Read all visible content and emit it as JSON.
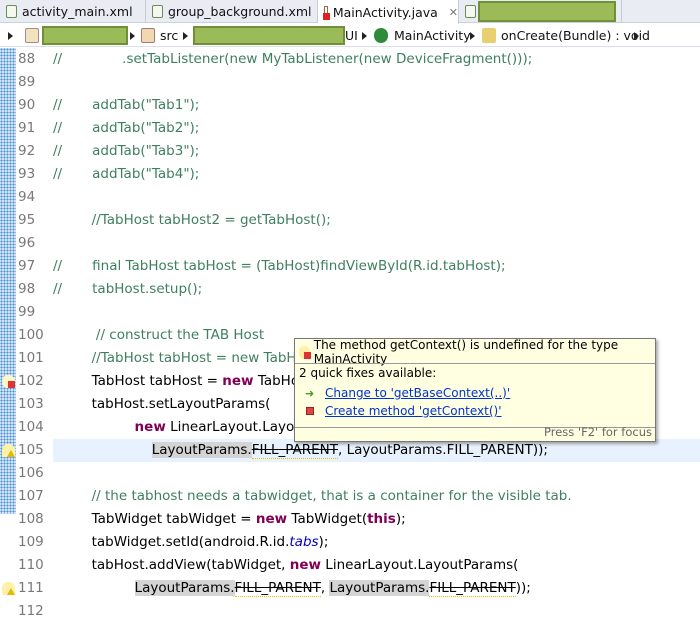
{
  "tabs": [
    {
      "label": "activity_main.xml",
      "icon": "xml-file-icon"
    },
    {
      "label": "group_background.xml",
      "icon": "xml-file-icon"
    },
    {
      "label": "MainActivity.java",
      "icon": "java-file-error-icon",
      "active": true,
      "close": "✕"
    },
    {
      "label": "",
      "icon": "xml-file-icon",
      "redacted": true
    }
  ],
  "breadcrumb": {
    "project": "",
    "src": "src",
    "package_suffix": "UI",
    "class": "MainActivity",
    "method": "onCreate(Bundle) : void"
  },
  "editor": {
    "current_line": 105,
    "lines": [
      {
        "n": 88,
        "seg": [
          [
            "//              .setTabListener(new MyTabListener(new DeviceFragment()));",
            "comment"
          ]
        ]
      },
      {
        "n": 89,
        "seg": []
      },
      {
        "n": 90,
        "seg": [
          [
            "//       addTab(\"Tab1\");",
            "comment"
          ]
        ]
      },
      {
        "n": 91,
        "seg": [
          [
            "//       addTab(\"Tab2\");",
            "comment"
          ]
        ]
      },
      {
        "n": 92,
        "seg": [
          [
            "//       addTab(\"Tab3\");",
            "comment"
          ]
        ]
      },
      {
        "n": 93,
        "seg": [
          [
            "//       addTab(\"Tab4\");",
            "comment"
          ]
        ]
      },
      {
        "n": 94,
        "seg": []
      },
      {
        "n": 95,
        "seg": [
          [
            "         //TabHost tabHost2 = getTabHost();",
            "comment"
          ]
        ]
      },
      {
        "n": 96,
        "seg": []
      },
      {
        "n": 97,
        "seg": [
          [
            "//       final TabHost tabHost = (TabHost)findViewById(R.id.tabHost);",
            "comment"
          ]
        ]
      },
      {
        "n": 98,
        "seg": [
          [
            "//       tabHost.setup();",
            "comment"
          ]
        ]
      },
      {
        "n": 99,
        "seg": []
      },
      {
        "n": 100,
        "seg": [
          [
            "          // construct the TAB Host",
            "comment"
          ]
        ]
      },
      {
        "n": 101,
        "seg": [
          [
            "         //TabHost tabHost = new TabHost(this);",
            "comment"
          ]
        ]
      },
      {
        "n": 102,
        "marker": "error",
        "seg": [
          [
            "         TabHost tabHost = ",
            ""
          ],
          [
            "new",
            "kw"
          ],
          [
            " TabHost(",
            ""
          ],
          [
            "getContext",
            "spell"
          ],
          [
            "(), ",
            ""
          ],
          [
            "null",
            "kw"
          ],
          [
            ");",
            ""
          ]
        ]
      },
      {
        "n": 103,
        "seg": [
          [
            "         tabHost.setLayoutParams(",
            ""
          ]
        ]
      },
      {
        "n": 104,
        "seg": [
          [
            "                   ",
            ""
          ],
          [
            "new",
            "kw"
          ],
          [
            " LinearLayout.LayoutParams(",
            ""
          ]
        ]
      },
      {
        "n": 105,
        "marker": "warning",
        "seg": [
          [
            "                       ",
            ""
          ],
          [
            "LayoutParams.",
            "hl"
          ],
          [
            "FILL_PARENT",
            "dep"
          ],
          [
            ", LayoutParams.FILL_PARENT));",
            ""
          ]
        ]
      },
      {
        "n": 106,
        "seg": []
      },
      {
        "n": 107,
        "seg": [
          [
            "         // the tabhost needs a tabwidget, that is a container for the visible tab.",
            "comment"
          ]
        ]
      },
      {
        "n": 108,
        "seg": [
          [
            "         TabWidget tabWidget = ",
            ""
          ],
          [
            "new",
            "kw"
          ],
          [
            " TabWidget(",
            ""
          ],
          [
            "this",
            "kw"
          ],
          [
            ");",
            ""
          ]
        ]
      },
      {
        "n": 109,
        "seg": [
          [
            "         tabWidget.setId(android.R.id.",
            ""
          ],
          [
            "tabs",
            "field"
          ],
          [
            ");",
            ""
          ]
        ]
      },
      {
        "n": 110,
        "seg": [
          [
            "         tabHost.addView(tabWidget, ",
            ""
          ],
          [
            "new",
            "kw"
          ],
          [
            " LinearLayout.LayoutParams(",
            ""
          ]
        ]
      },
      {
        "n": 111,
        "marker": "warning",
        "seg": [
          [
            "                   ",
            ""
          ],
          [
            "LayoutParams.",
            "hl"
          ],
          [
            "FILL_PARENT",
            "dep"
          ],
          [
            ", ",
            ""
          ],
          [
            "LayoutParams.",
            "hl"
          ],
          [
            "FILL_PARENT",
            "dep"
          ],
          [
            "));",
            ""
          ]
        ]
      },
      {
        "n": 112,
        "seg": []
      }
    ]
  },
  "hover": {
    "message": "The method getContext() is undefined for the type MainActivity",
    "count_text": "2 quick fixes available:",
    "fixes": [
      {
        "label": "Change to 'getBaseContext(..)'",
        "icon": "rename-arrow-icon"
      },
      {
        "label": "Create method 'getContext()'",
        "icon": "method-icon"
      }
    ],
    "footer": "Press 'F2' for focus"
  },
  "colors": {
    "keyword": "#7f0055",
    "comment": "#3f7f5f",
    "field": "#0000c0",
    "redaction": "#9bbb59"
  }
}
